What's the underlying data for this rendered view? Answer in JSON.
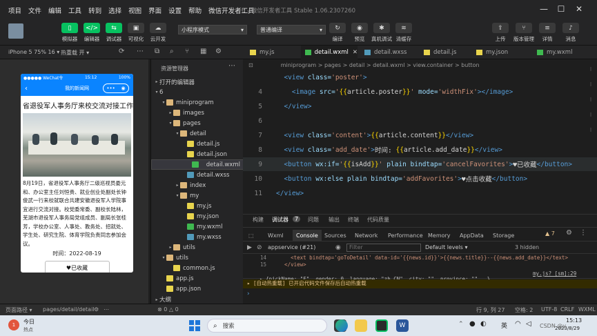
{
  "menubar": {
    "items": [
      "项目",
      "文件",
      "编辑",
      "工具",
      "转到",
      "选择",
      "视图",
      "界面",
      "设置",
      "帮助",
      "微信开发者工具"
    ],
    "title": "6 - 微信开发者工具 Stable 1.06.2307260"
  },
  "toolbar": {
    "left_buttons": [
      {
        "label": "模拟器",
        "icon": "phone-icon"
      },
      {
        "label": "编辑器",
        "icon": "code-icon"
      },
      {
        "label": "调试器",
        "icon": "debug-icon"
      },
      {
        "label": "可视化",
        "icon": "visual-icon"
      },
      {
        "label": "云开发",
        "icon": "cloud-icon"
      }
    ],
    "mode_select": "小程序模式",
    "compile_select": "普通编译",
    "mid_buttons": [
      {
        "label": "编译",
        "icon": "refresh-icon"
      },
      {
        "label": "预览",
        "icon": "eye-icon"
      },
      {
        "label": "真机调试",
        "icon": "bug-icon"
      },
      {
        "label": "清缓存",
        "icon": "layers-icon"
      }
    ],
    "right_buttons": [
      {
        "label": "上传",
        "icon": "upload-icon"
      },
      {
        "label": "版本管理",
        "icon": "branch-icon"
      },
      {
        "label": "详情",
        "icon": "details-icon"
      },
      {
        "label": "消息",
        "icon": "bell-icon"
      }
    ]
  },
  "subbar": {
    "device": "iPhone 5 75% 16 ▾",
    "hot_reload": "热重载 开 ▾"
  },
  "phone": {
    "status_left": "●●●●● WeChat令",
    "status_time": "15:12",
    "status_right": "100%",
    "nav_title": "我的新闻网",
    "article_title": "省退役军人事务厅来校交流对接工作",
    "content": "8月19日，省退役军人事务厅二级巡视员娄元和、办公室主任刘恒贵、就业创业处副处长钟俊武一行来校就联合共建安徽退役军人学院事宜进行交流对接。校党委常委、副校长陆林，芜湖市退役军人事务局党组成员、副局长张桂芳，学校办公室、人事处、教务处、招就处、学生处、研究生院、体育学院负责同志参加会议。",
    "date": "时间：2022-08-19",
    "button": "♥已收藏"
  },
  "explorer": {
    "title": "资源管理器",
    "open_editors": "打开的编辑器",
    "root": "6",
    "items": [
      {
        "label": "miniprogram",
        "depth": 1,
        "arrow": "▾",
        "kind": "folder"
      },
      {
        "label": "images",
        "depth": 2,
        "arrow": "▸",
        "kind": "folder"
      },
      {
        "label": "pages",
        "depth": 2,
        "arrow": "▾",
        "kind": "folder"
      },
      {
        "label": "detail",
        "depth": 3,
        "arrow": "▾",
        "kind": "folder"
      },
      {
        "label": "detail.js",
        "depth": 4,
        "arrow": "",
        "kind": "js"
      },
      {
        "label": "detail.json",
        "depth": 4,
        "arrow": "",
        "kind": "json"
      },
      {
        "label": "detail.wxml",
        "depth": 4,
        "arrow": "",
        "kind": "wxml",
        "selected": true
      },
      {
        "label": "detail.wxss",
        "depth": 4,
        "arrow": "",
        "kind": "wxss"
      },
      {
        "label": "index",
        "depth": 3,
        "arrow": "▸",
        "kind": "folder"
      },
      {
        "label": "my",
        "depth": 3,
        "arrow": "▾",
        "kind": "folder"
      },
      {
        "label": "my.js",
        "depth": 4,
        "arrow": "",
        "kind": "js"
      },
      {
        "label": "my.json",
        "depth": 4,
        "arrow": "",
        "kind": "json"
      },
      {
        "label": "my.wxml",
        "depth": 4,
        "arrow": "",
        "kind": "wxml"
      },
      {
        "label": "my.wxss",
        "depth": 4,
        "arrow": "",
        "kind": "wxss"
      },
      {
        "label": "utils",
        "depth": 2,
        "arrow": "▸",
        "kind": "folder"
      },
      {
        "label": "utils",
        "depth": 1,
        "arrow": "▾",
        "kind": "folder"
      },
      {
        "label": "common.js",
        "depth": 2,
        "arrow": "",
        "kind": "js"
      },
      {
        "label": "app.js",
        "depth": 1,
        "arrow": "",
        "kind": "js"
      },
      {
        "label": "app.json",
        "depth": 1,
        "arrow": "",
        "kind": "json"
      }
    ],
    "outline": "大纲"
  },
  "tabs": [
    {
      "label": "my.js",
      "icon": "js"
    },
    {
      "label": "detail.wxml",
      "icon": "wxml",
      "active": true
    },
    {
      "label": "detail.wxss",
      "icon": "wxss"
    },
    {
      "label": "detail.js",
      "icon": "js"
    },
    {
      "label": "my.json",
      "icon": "json"
    },
    {
      "label": "my.wxml",
      "icon": "wxml"
    }
  ],
  "breadcrumb": "miniprogram > pages > detail > detail.wxml > view.container > button",
  "code": [
    {
      "n": "",
      "parts": [
        [
          "tg",
          "  <view "
        ],
        [
          "at",
          "class="
        ],
        [
          "st",
          "'poster'"
        ],
        [
          "tg",
          ">"
        ]
      ]
    },
    {
      "n": "4",
      "parts": [
        [
          "tg",
          "    <image "
        ],
        [
          "at",
          "src="
        ],
        [
          "st",
          "'"
        ],
        [
          "br",
          "{{"
        ],
        [
          "tx",
          "article.poster"
        ],
        [
          "br",
          "}}"
        ],
        [
          "st",
          "'"
        ],
        [
          "at",
          " mode="
        ],
        [
          "st",
          "'widthFix'"
        ],
        [
          "tg",
          "></image>"
        ]
      ]
    },
    {
      "n": "5",
      "parts": [
        [
          "tg",
          "  </view>"
        ]
      ]
    },
    {
      "n": "6",
      "parts": []
    },
    {
      "n": "7",
      "parts": [
        [
          "tg",
          "  <view "
        ],
        [
          "at",
          "class="
        ],
        [
          "st",
          "'content'"
        ],
        [
          "tg",
          ">"
        ],
        [
          "br",
          "{{"
        ],
        [
          "tx",
          "article.content"
        ],
        [
          "br",
          "}}"
        ],
        [
          "tg",
          "</view>"
        ]
      ]
    },
    {
      "n": "8",
      "parts": [
        [
          "tg",
          "  <view "
        ],
        [
          "at",
          "class="
        ],
        [
          "st",
          "'add_date'"
        ],
        [
          "tg",
          ">"
        ],
        [
          "tx",
          "时间: "
        ],
        [
          "br",
          "{{"
        ],
        [
          "tx",
          "article.add_date"
        ],
        [
          "br",
          "}}"
        ],
        [
          "tg",
          "</view>"
        ]
      ]
    },
    {
      "n": "9",
      "hl": true,
      "parts": [
        [
          "tg",
          "  <button "
        ],
        [
          "at",
          "wx:if="
        ],
        [
          "st",
          "'"
        ],
        [
          "br",
          "{{"
        ],
        [
          "tx",
          "isAdd"
        ],
        [
          "br",
          "}}"
        ],
        [
          "st",
          "'"
        ],
        [
          "at",
          " plain bindtap="
        ],
        [
          "st",
          "'cancelFavorites'"
        ],
        [
          "tg",
          ">"
        ],
        [
          "tx",
          "♥已收藏"
        ],
        [
          "tg",
          "</button>"
        ]
      ]
    },
    {
      "n": "10",
      "parts": [
        [
          "tg",
          "  <button "
        ],
        [
          "at",
          "wx:else plain bindtap="
        ],
        [
          "st",
          "'addFavorites'"
        ],
        [
          "tg",
          ">"
        ],
        [
          "tx",
          "♥点击收藏"
        ],
        [
          "tg",
          "</button>"
        ]
      ]
    },
    {
      "n": "11",
      "parts": [
        [
          "tg",
          "</view>"
        ]
      ]
    }
  ],
  "debug": {
    "top_tabs": [
      "构建",
      "调试器",
      "问题",
      "输出",
      "终端",
      "代码质量"
    ],
    "badge": "7",
    "dev_tabs": [
      "Wxml",
      "Console",
      "Sources",
      "Network",
      "Performance",
      "Memory",
      "AppData",
      "Storage"
    ],
    "warn_count": "▲ 7",
    "context": "appservice (#21)",
    "filter_placeholder": "Filter",
    "levels": "Default levels ▾",
    "hidden": "3 hidden",
    "lines": [
      {
        "n": "14",
        "text": "      <text bindtap='goToDetail' data-id='{{news.id}}'>{{news.title}}--{{news.add_date}}</text>"
      },
      {
        "n": "15",
        "text": "    </view>"
      }
    ],
    "obj": "▸ {nickName: \"F\", gender: 0, language: \"zh_CN\", city: \"\", province: \"\", …}",
    "obj_src": "my.js?_[sm]:29",
    "notice": "▸ [自动热重载] 已开启代码文件保存后自动热重载"
  },
  "status": {
    "path_label": "页面路径 ▾",
    "path": "pages/detail/detail",
    "errors": "⊗ 0 △ 0",
    "pos": "行 9, 列 27",
    "spaces": "空格: 2",
    "enc": "UTF-8",
    "eol": "CRLF",
    "lang": "WXML"
  },
  "taskbar": {
    "weather_day": "今日",
    "weather_note": "热点",
    "search": "搜索",
    "ime": "英",
    "time": "15:13",
    "date": "2023/8/29",
    "watermark": "CSDN @y"
  },
  "colors": {
    "accent": "#07c160",
    "nav_blue": "#0a84ff",
    "editor_bg": "#1e1e1e"
  }
}
